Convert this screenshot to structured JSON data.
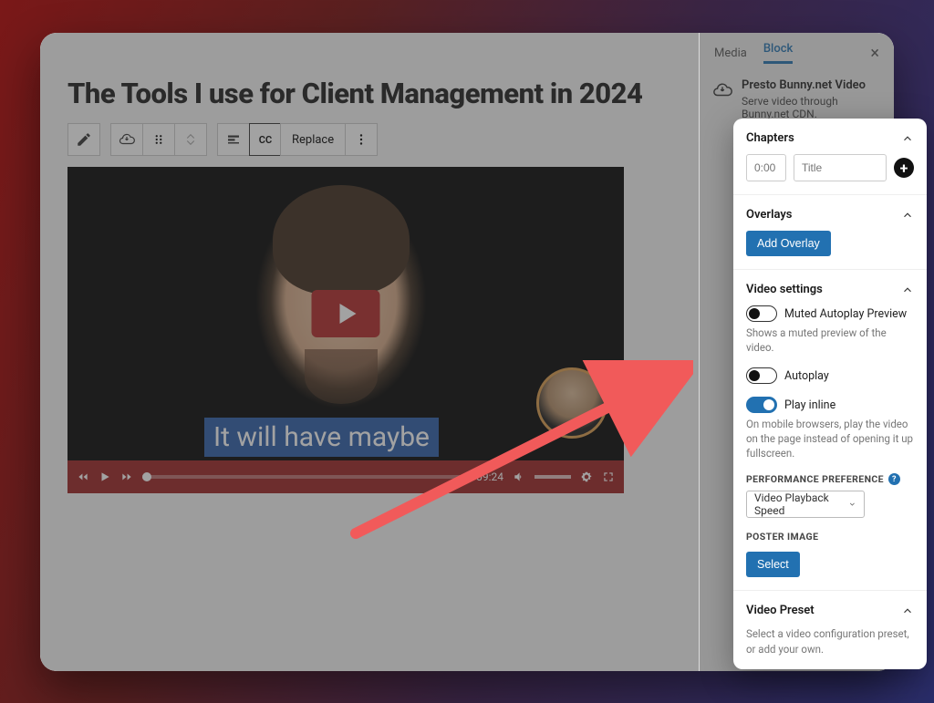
{
  "editor": {
    "title": "The Tools I use for Client Management in 2024",
    "toolbar": {
      "replace_label": "Replace",
      "cc_label": "CC"
    },
    "video": {
      "caption": "It will have maybe",
      "timecode": "09:24"
    }
  },
  "sidebar": {
    "tabs": {
      "media": "Media",
      "block": "Block"
    },
    "block_info": {
      "title": "Presto Bunny.net Video",
      "desc": "Serve video through Bunny.net CDN."
    }
  },
  "panel": {
    "chapters": {
      "title": "Chapters",
      "time_placeholder": "0:00",
      "title_placeholder": "Title"
    },
    "overlays": {
      "title": "Overlays",
      "add_label": "Add Overlay"
    },
    "video_settings": {
      "title": "Video settings",
      "muted_autoplay": {
        "label": "Muted Autoplay Preview",
        "desc": "Shows a muted preview of the video.",
        "on": false
      },
      "autoplay": {
        "label": "Autoplay",
        "on": false
      },
      "play_inline": {
        "label": "Play inline",
        "desc": "On mobile browsers, play the video on the page instead of opening it up fullscreen.",
        "on": true
      },
      "perf_heading": "PERFORMANCE PREFERENCE",
      "perf_selected": "Video Playback Speed",
      "poster_heading": "POSTER IMAGE",
      "poster_select": "Select"
    },
    "preset": {
      "title": "Video Preset",
      "desc": "Select a video configuration preset, or add your own."
    }
  }
}
